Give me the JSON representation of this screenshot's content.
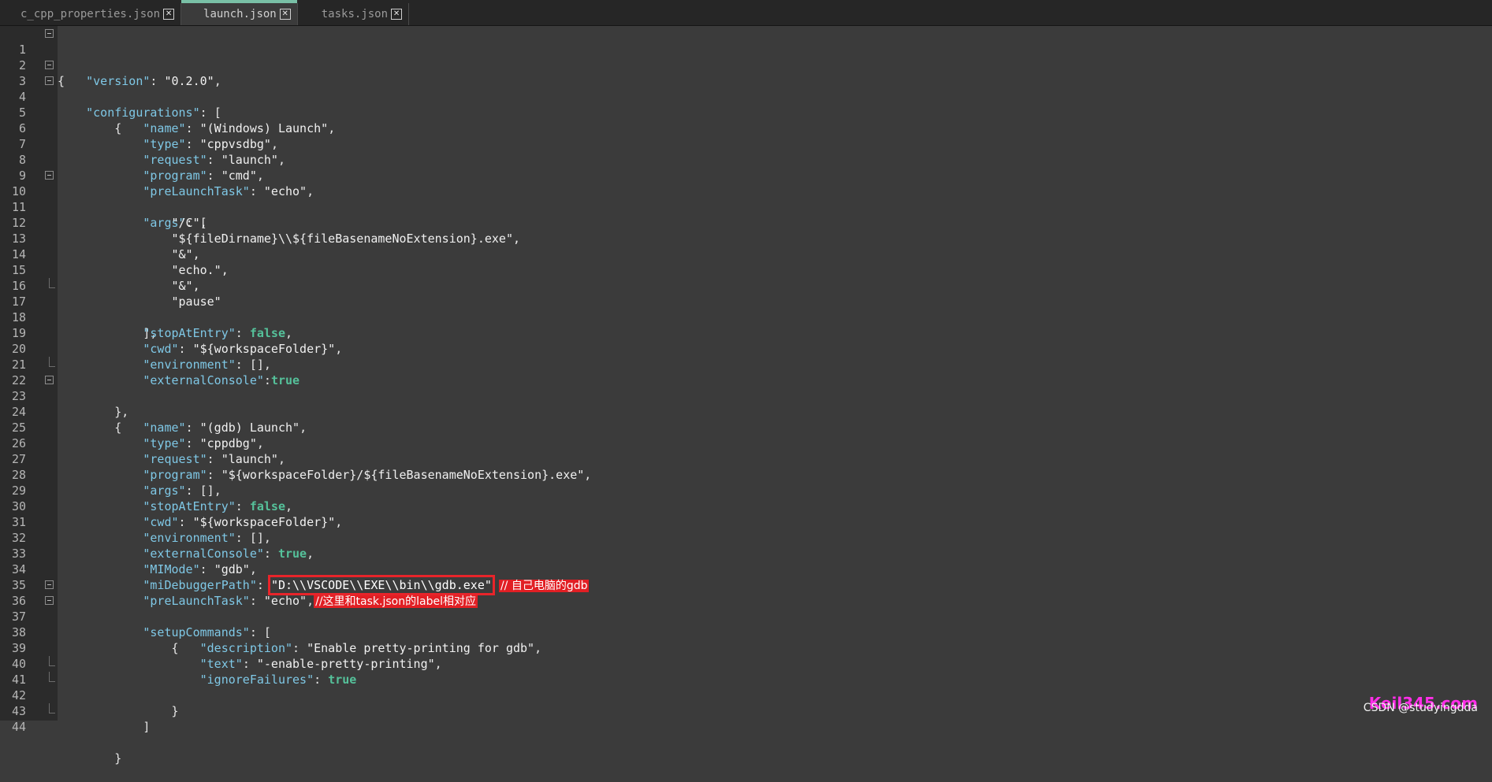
{
  "tabs": [
    {
      "label": "c_cpp_properties.json",
      "active": false
    },
    {
      "label": "launch.json",
      "active": true
    },
    {
      "label": "tasks.json",
      "active": false
    }
  ],
  "close_glyph": "✕",
  "lines": [
    {
      "n": "1",
      "fold": "open"
    },
    {
      "n": "2"
    },
    {
      "n": "3",
      "fold": "open"
    },
    {
      "n": "4",
      "fold": "open"
    },
    {
      "n": "5"
    },
    {
      "n": "6"
    },
    {
      "n": "7"
    },
    {
      "n": "8"
    },
    {
      "n": "9"
    },
    {
      "n": "10",
      "fold": "open"
    },
    {
      "n": "11"
    },
    {
      "n": "12"
    },
    {
      "n": "13"
    },
    {
      "n": "14"
    },
    {
      "n": "15"
    },
    {
      "n": "16"
    },
    {
      "n": "17",
      "fold": "end"
    },
    {
      "n": "18"
    },
    {
      "n": "19"
    },
    {
      "n": "20"
    },
    {
      "n": "21"
    },
    {
      "n": "22",
      "fold": "end"
    },
    {
      "n": "23",
      "fold": "open"
    },
    {
      "n": "24"
    },
    {
      "n": "25"
    },
    {
      "n": "26"
    },
    {
      "n": "27"
    },
    {
      "n": "28"
    },
    {
      "n": "29"
    },
    {
      "n": "30"
    },
    {
      "n": "31"
    },
    {
      "n": "32"
    },
    {
      "n": "33"
    },
    {
      "n": "34"
    },
    {
      "n": "35"
    },
    {
      "n": "36",
      "fold": "open"
    },
    {
      "n": "37",
      "fold": "open"
    },
    {
      "n": "38"
    },
    {
      "n": "39"
    },
    {
      "n": "40"
    },
    {
      "n": "41",
      "fold": "end"
    },
    {
      "n": "42",
      "fold": "end"
    },
    {
      "n": "43"
    },
    {
      "n": "44",
      "fold": "end"
    }
  ],
  "code": {
    "l1": "{",
    "l2_key": "\"version\"",
    "l2_val": "\"0.2.0\"",
    "l3_key": "\"configurations\"",
    "l3_rest": "[",
    "l4": "{",
    "l5_key": "\"name\"",
    "l5_val": "\"(Windows) Launch\"",
    "l6_key": "\"type\"",
    "l6_val": "\"cppvsdbg\"",
    "l7_key": "\"request\"",
    "l7_val": "\"launch\"",
    "l8_key": "\"program\"",
    "l8_val": "\"cmd\"",
    "l9_key": "\"preLaunchTask\"",
    "l9_val": "\"echo\"",
    "l10_key": "\"args\"",
    "l10_rest": "[",
    "l11": "\"/C\",",
    "l12": "\"${fileDirname}\\\\${fileBasenameNoExtension}.exe\",",
    "l13": "\"&\",",
    "l14": "\"echo.\",",
    "l15": "\"&\",",
    "l16": "\"pause\"",
    "l17": "],",
    "l18_key": "\"stopAtEntry\"",
    "l18_val": "false",
    "l19_key": "\"cwd\"",
    "l19_val": "\"${workspaceFolder}\"",
    "l20_key": "\"environment\"",
    "l20_val": "[]",
    "l21_key": "\"externalConsole\"",
    "l21_val": "true",
    "l22": "},",
    "l23": "{",
    "l24_key": "\"name\"",
    "l24_val": "\"(gdb) Launch\"",
    "l25_key": "\"type\"",
    "l25_val": "\"cppdbg\"",
    "l26_key": "\"request\"",
    "l26_val": "\"launch\"",
    "l27_key": "\"program\"",
    "l27_val": "\"${workspaceFolder}/${fileBasenameNoExtension}.exe\"",
    "l28_key": "\"args\"",
    "l28_val": "[]",
    "l29_key": "\"stopAtEntry\"",
    "l29_val": "false",
    "l30_key": "\"cwd\"",
    "l30_val": "\"${workspaceFolder}\"",
    "l31_key": "\"environment\"",
    "l31_val": "[]",
    "l32_key": "\"externalConsole\"",
    "l32_val": "true",
    "l33_key": "\"MIMode\"",
    "l33_val": "\"gdb\"",
    "l34_key": "\"miDebuggerPath\"",
    "l34_val": "\"D:\\\\VSCODE\\\\EXE\\\\bin\\\\gdb.exe\"",
    "l34_comment": "// 自己电脑的gdb",
    "l35_key": "\"preLaunchTask\"",
    "l35_val": "\"echo\"",
    "l35_comment": "//这里和task.json的label相对应",
    "l36_key": "\"setupCommands\"",
    "l36_rest": "[",
    "l37": "{",
    "l38_key": "\"description\"",
    "l38_val": "\"Enable pretty-printing for gdb\"",
    "l39_key": "\"text\"",
    "l39_val": "\"-enable-pretty-printing\"",
    "l40_key": "\"ignoreFailures\"",
    "l40_val": "true",
    "l41": "}",
    "l42": "]",
    "l43": "",
    "l44": "}"
  },
  "watermark": {
    "brand": "Keil345.com",
    "credit": "CSDN @studyingdda"
  }
}
